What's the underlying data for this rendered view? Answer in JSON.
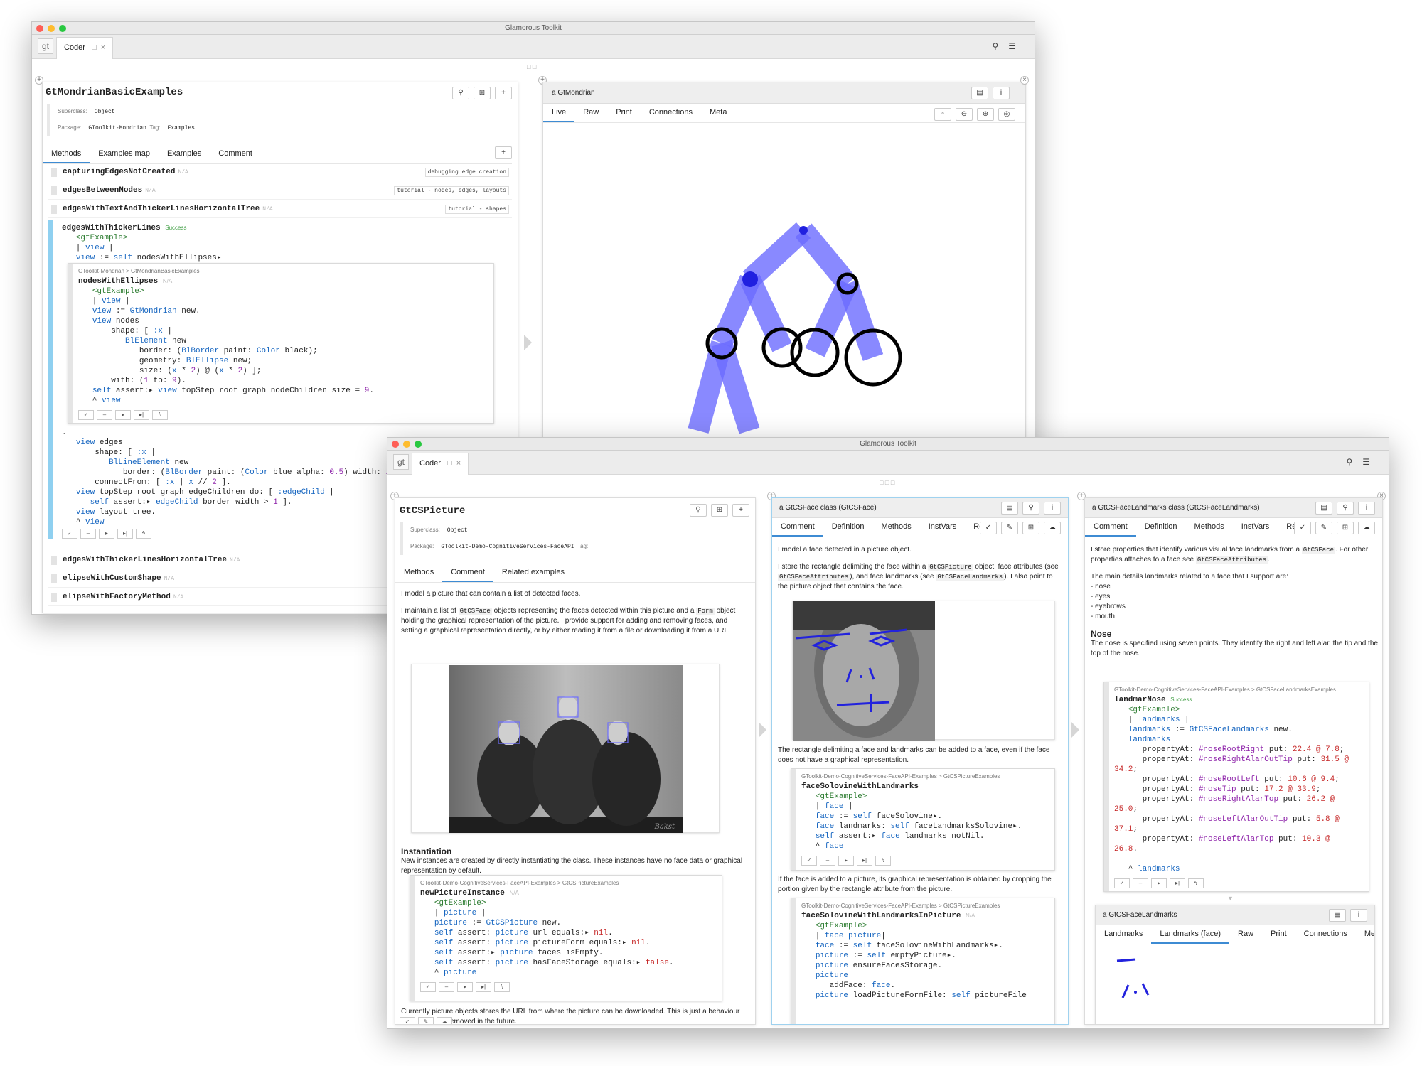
{
  "back": {
    "title": "Glamorous Toolkit",
    "gt": "gt",
    "tab": "Coder",
    "tab_pin": "□",
    "tab_close": "×",
    "class_name": "GtMondrianBasicExamples",
    "superclass_label": "Superclass:",
    "superclass": "Object",
    "package_label": "Package:",
    "package": "GToolkit-Mondrian",
    "tag_label": "Tag:",
    "tag": "Examples",
    "tabs": [
      "Methods",
      "Examples map",
      "Examples",
      "Comment"
    ],
    "methods_top": [
      {
        "name": "capturingEdgesNotCreated",
        "na": "N/A",
        "tag": "debugging edge creation"
      },
      {
        "name": "edgesBetweenNodes",
        "na": "N/A",
        "tag": "tutorial - nodes, edges, layouts"
      },
      {
        "name": "edgesWithTextAndThickerLinesHorizontalTree",
        "na": "N/A",
        "tag": "tutorial - shapes"
      }
    ],
    "expanded": {
      "name": "edgesWithThickerLines",
      "status": "Success",
      "embed_crumb": "GToolkit-Mondrian  >  GtMondrianBasicExamples",
      "embed_name": "nodesWithEllipses",
      "embed_na": "N/A"
    },
    "methods_bottom": [
      {
        "name": "edgesWithThickerLinesHorizontalTree",
        "na": "N/A"
      },
      {
        "name": "elipseWithCustomShape",
        "na": "N/A"
      },
      {
        "name": "elipseWithFactoryMethod",
        "na": "N/A"
      }
    ],
    "inspector": {
      "title": "a GtMondrian",
      "tabs": [
        "Live",
        "Raw",
        "Print",
        "Connections",
        "Meta"
      ]
    }
  },
  "front": {
    "title": "Glamorous Toolkit",
    "gt": "gt",
    "tab": "Coder",
    "tab_pin": "□",
    "tab_close": "×",
    "class_name": "GtCSPicture",
    "superclass_label": "Superclass:",
    "superclass": "Object",
    "package_label": "Package:",
    "package": "GToolkit-Demo-CognitiveServices-FaceAPI",
    "tag_label": "Tag:",
    "tabs": [
      "Methods",
      "Comment",
      "Related examples"
    ],
    "c1": "I model a picture that can contain a list of detected faces.",
    "c2a": "I maintain a list of ",
    "c2m1": "GtCSFace",
    "c2b": " objects representing the faces detected within this picture and a ",
    "c2m2": "Form",
    "c2c": " object holding the graphical representation of the picture. I provide support for adding and removing faces, and setting a graphical representation directly, or by either reading it from a file or downloading it from a URL.",
    "inst_h": "Instantiation",
    "inst_t": "New instances are created by directly instantiating the class. These instances have no face data or graphical representation by default.",
    "ex_crumb": "GToolkit-Demo-CognitiveServices-FaceAPI-Examples  >  GtCSPictureExamples",
    "ex_name": "newPictureInstance",
    "ex_na": "N/A",
    "footer": "Currently picture objects stores the URL from where the picture can be downloaded. This is just a behaviour and should be removed in the future.",
    "face": {
      "title": "a GtCSFace class (GtCSFace)",
      "tabs": [
        "Comment",
        "Definition",
        "Methods",
        "InstVars",
        "Re"
      ],
      "t1": "I model a face detected in a picture object.",
      "t2": "I store the rectangle delimiting the face within a ",
      "m1": "GtCSPicture",
      "t3": " object, face attributes (see ",
      "m2": "GtCSFaceAttributes",
      "t4": "), and face landmarks (see ",
      "m3": "GtCSFaceLandmarks",
      "t5": "). I also point to the picture object that contains the face.",
      "t6": "The rectangle delimiting a face and landmarks can be added to a face, even if the face does not have a graphical representation.",
      "e1_crumb": "GToolkit-Demo-CognitiveServices-FaceAPI-Examples  >  GtCSPictureExamples",
      "e1_name": "faceSolovineWithLandmarks",
      "t7": "If the face is added to a picture, its graphical representation is obtained by cropping the portion given by the rectangle attribute from the picture.",
      "e2_crumb": "GToolkit-Demo-CognitiveServices-FaceAPI-Examples  >  GtCSPictureExamples",
      "e2_name": "faceSolovineWithLandmarksInPicture",
      "e2_na": "N/A"
    },
    "land": {
      "title": "a GtCSFaceLandmarks class (GtCSFaceLandmarks)",
      "tabs": [
        "Comment",
        "Definition",
        "Methods",
        "InstVars",
        "Referer"
      ],
      "t1": "I store properties that identify various visual face landmarks from a ",
      "m1": "GtCSFace",
      "t2": ". For other properties attaches to a face see ",
      "m2": "GtCSFaceAttributes",
      "t3": ".",
      "t4": "The main details landmarks related to a face that I support are:",
      "list": [
        "- nose",
        "- eyes",
        "- eyebrows",
        "- mouth"
      ],
      "nose_h": "Nose",
      "nose_t": "The nose is specified using seven points. They identify the right and left alar, the tip and the top of the nose.",
      "e_crumb": "GToolkit-Demo-CognitiveServices-FaceAPI-Examples  >  GtCSFaceLandmarksExamples",
      "e_name": "landmarNose",
      "e_status": "Success",
      "insp_title": "a GtCSFaceLandmarks",
      "insp_tabs": [
        "Landmarks",
        "Landmarks (face)",
        "Raw",
        "Print",
        "Connections",
        "Meta"
      ]
    },
    "photo_sig": "Bakst"
  },
  "colors": {
    "accent": "#3d8bd3",
    "mondrian": "#6b6bff",
    "node": "#2020e0"
  }
}
